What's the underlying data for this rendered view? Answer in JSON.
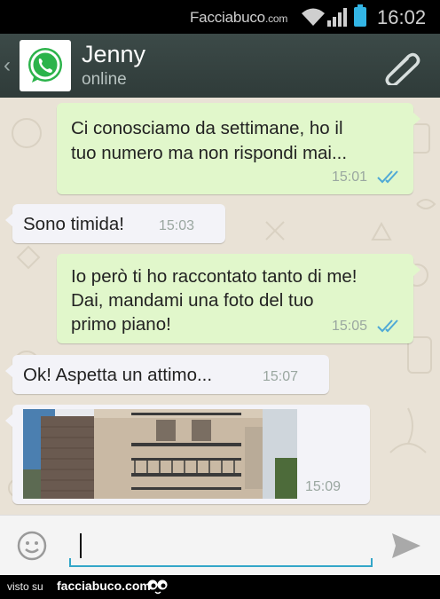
{
  "status_bar": {
    "brand": "Facciabuco",
    "brand_domain": ".com",
    "time": "16:02",
    "battery_color": "#33b5e5"
  },
  "header": {
    "back_icon": "chevron-left-icon",
    "avatar_icon": "whatsapp-logo-icon",
    "contact_name": "Jenny",
    "contact_status": "online",
    "attach_icon": "paperclip-icon"
  },
  "messages": [
    {
      "direction": "out",
      "lines": [
        "Ci conosciamo da settimane, ho il",
        "tuo numero ma non rispondi mai..."
      ],
      "time": "15:01",
      "read": true
    },
    {
      "direction": "in",
      "lines": [
        "Sono timida!"
      ],
      "time": "15:03"
    },
    {
      "direction": "out",
      "lines": [
        "Io però ti ho raccontato tanto di me!",
        "Dai, mandami una foto del tuo",
        "primo piano!"
      ],
      "time": "15:05",
      "read": true
    },
    {
      "direction": "in",
      "lines": [
        "Ok! Aspetta un attimo..."
      ],
      "time": "15:07"
    },
    {
      "direction": "in",
      "type": "image",
      "image_desc_icon": "photo-building-icon",
      "time": "15:09"
    }
  ],
  "composer": {
    "emoji_icon": "smiley-icon",
    "input_value": "",
    "send_icon": "send-arrow-icon",
    "accent_color": "#33a6c8"
  },
  "footer": {
    "visto_text": "visto su",
    "site": "facciabuco.com"
  },
  "colors": {
    "outgoing_bubble": "#e1f7cb",
    "incoming_bubble": "#f3f3f8",
    "chat_background": "#e9e2d6",
    "read_ticks": "#4fa9d6"
  }
}
